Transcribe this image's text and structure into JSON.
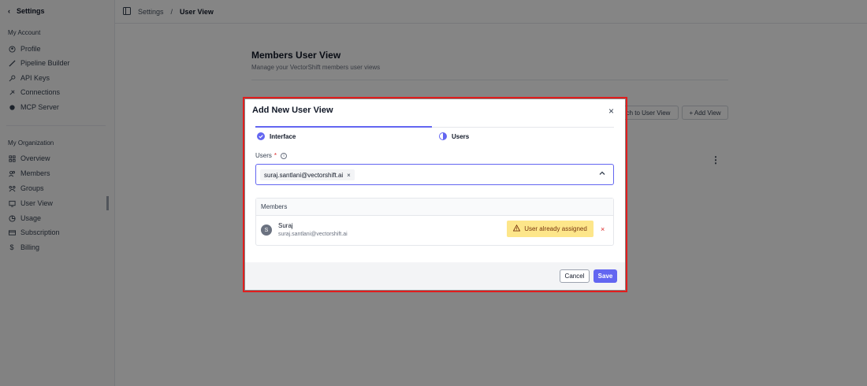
{
  "sidebar": {
    "back_label": "Settings",
    "account_title": "My Account",
    "account_items": [
      {
        "label": "Profile",
        "icon": "user-circle-icon"
      },
      {
        "label": "Pipeline Builder",
        "icon": "pipeline-icon"
      },
      {
        "label": "API Keys",
        "icon": "key-icon"
      },
      {
        "label": "Connections",
        "icon": "plug-icon"
      },
      {
        "label": "MCP Server",
        "icon": "server-icon"
      }
    ],
    "org_title": "My Organization",
    "org_items": [
      {
        "label": "Overview",
        "icon": "grid-icon"
      },
      {
        "label": "Members",
        "icon": "users-icon"
      },
      {
        "label": "Groups",
        "icon": "groups-icon"
      },
      {
        "label": "User View",
        "icon": "monitor-icon",
        "active": true
      },
      {
        "label": "Usage",
        "icon": "chart-pie-icon"
      },
      {
        "label": "Subscription",
        "icon": "card-icon"
      },
      {
        "label": "Billing",
        "icon": "dollar-icon"
      }
    ]
  },
  "header": {
    "crumb_root": "Settings",
    "crumb_sep": "/",
    "crumb_current": "User View"
  },
  "page": {
    "title": "Members User View",
    "subtitle": "Manage your VectorShift members user views",
    "switch_button": "ch to User View",
    "add_button": "+ Add View"
  },
  "modal": {
    "title": "Add New User View",
    "close": "×",
    "steps": [
      {
        "label": "Interface",
        "state": "complete"
      },
      {
        "label": "Users",
        "state": "in-progress"
      }
    ],
    "users_label": "Users",
    "required_mark": "*",
    "selected_chip": "suraj.santlani@vectorshift.ai",
    "members_header": "Members",
    "member": {
      "initial": "S",
      "name": "Suraj",
      "email": "suraj.santlani@vectorshift.ai",
      "status": "User already assigned"
    },
    "cancel_label": "Cancel",
    "save_label": "Save"
  },
  "colors": {
    "accent": "#6366f1",
    "highlight_frame": "#e11d1d",
    "warning_bg": "#fde68a",
    "remove": "#dc2626"
  }
}
